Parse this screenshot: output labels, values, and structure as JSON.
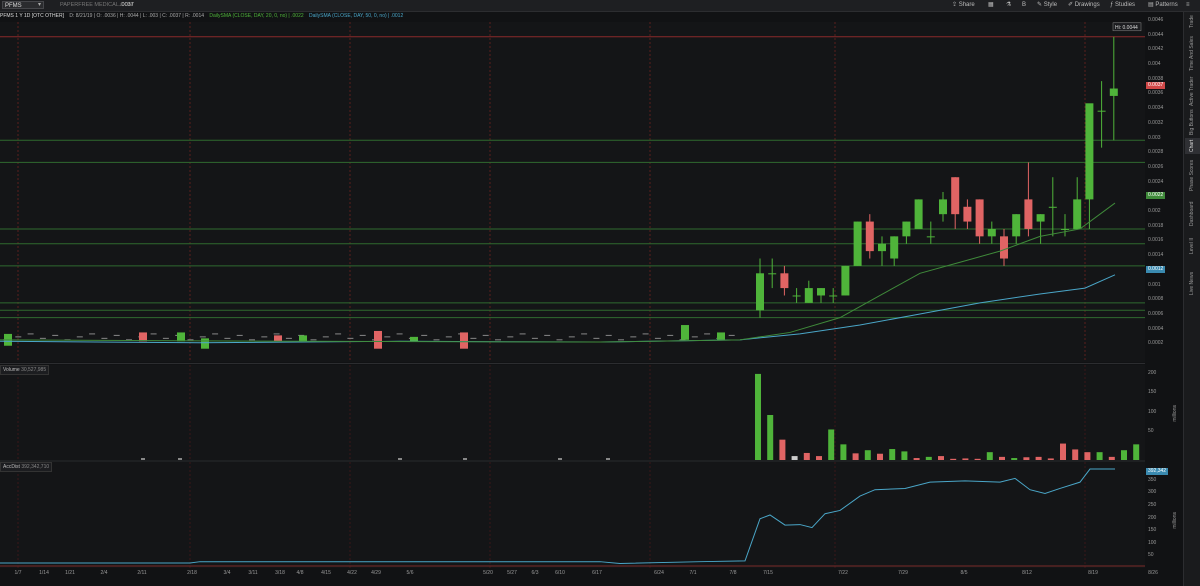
{
  "toolbar": {
    "symbol": "PFMS",
    "symbol_dropdown": "▾",
    "company_name": "PAPERFREE MEDICAL.COM",
    "last_price": ".0037",
    "share_label": "Share",
    "style_label": "Style",
    "drawings_label": "Drawings",
    "studies_label": "Studies",
    "patterns_label": "Patterns"
  },
  "chart_header": {
    "title": "PFMS 1 Y 1D [OTC OTHER]",
    "ohlc": "D: 8/21/19 | O: .0036 | H: .0044 | L: .003 | C: .0037 | R: .0014",
    "sma20": "DailySMA (CLOSE, DAY, 20, 0, no) | .0022",
    "sma50": "DailySMA (CLOSE, DAY, 50, 0, no) | .0012"
  },
  "sidebar_tabs": [
    "Trade",
    "Time And Sales",
    "Active Trader",
    "Big Buttons",
    "Chart",
    "Phase Scores",
    "Dashboard",
    "Level II",
    "Live News"
  ],
  "sidebar_active": "Chart",
  "price_axis": {
    "ticks": [
      "0.0046",
      "0.0044",
      "0.0042",
      "0.004",
      "0.0038",
      "0.0036",
      "0.0034",
      "0.0032",
      "0.003",
      "0.0028",
      "0.0026",
      "0.0024",
      "0.0022",
      "0.002",
      "0.0018",
      "0.0016",
      "0.0014",
      "0.0012",
      "0.001",
      "0.0008",
      "0.0006",
      "0.0004",
      "0.0002"
    ],
    "high_bubble": "Hi: 0.0044",
    "last_tag": "0.0037",
    "sma20_tag": "0.0022",
    "sma50_tag": "0.0012"
  },
  "volume_panel": {
    "label": "Volume",
    "value": "30,527,985",
    "unit": "millions",
    "ticks": [
      "200",
      "150",
      "100",
      "50"
    ]
  },
  "accdist_panel": {
    "label": "AccDist",
    "value": "392,342,710",
    "tag": "392,342",
    "unit": "millions",
    "ticks": [
      "350",
      "300",
      "250",
      "200",
      "150",
      "100",
      "50"
    ]
  },
  "x_axis": [
    "1/7",
    "1/14",
    "1/21",
    "2/4",
    "2/11",
    "2/18",
    "3/4",
    "3/11",
    "3/18",
    "4/8",
    "4/15",
    "4/22",
    "4/29",
    "5/6",
    "5/20",
    "5/27",
    "6/3",
    "6/10",
    "6/17",
    "6/24",
    "7/1",
    "7/8",
    "7/15",
    "7/22",
    "7/29",
    "8/5",
    "8/12",
    "8/19",
    "8/26"
  ],
  "colors": {
    "up": "#4fb43a",
    "down": "#e06464",
    "sma20": "#3f8a3a",
    "sma50": "#4aa6c8",
    "support": "#2f6a2f",
    "resistance": "#8a2a2a"
  },
  "chart_data": {
    "type": "candlestick",
    "ylim": [
      0,
      0.0046
    ],
    "support_levels": [
      0.003,
      0.0027,
      0.0018,
      0.0016,
      0.0013,
      0.0008,
      0.0007,
      0.0006
    ],
    "resistance_level": 0.0044,
    "candles": [
      {
        "x": "7/8",
        "o": 0.0007,
        "h": 0.0014,
        "l": 0.0006,
        "c": 0.0012
      },
      {
        "x": "7/9",
        "o": 0.0012,
        "h": 0.0014,
        "l": 0.001,
        "c": 0.0012
      },
      {
        "x": "7/10",
        "o": 0.0012,
        "h": 0.0013,
        "l": 0.0009,
        "c": 0.001
      },
      {
        "x": "7/11",
        "o": 0.0009,
        "h": 0.001,
        "l": 0.0008,
        "c": 0.0009
      },
      {
        "x": "7/12",
        "o": 0.0008,
        "h": 0.0011,
        "l": 0.0008,
        "c": 0.001
      },
      {
        "x": "7/15",
        "o": 0.0009,
        "h": 0.001,
        "l": 0.0008,
        "c": 0.001
      },
      {
        "x": "7/16",
        "o": 0.0009,
        "h": 0.001,
        "l": 0.0008,
        "c": 0.0009
      },
      {
        "x": "7/17",
        "o": 0.0009,
        "h": 0.0013,
        "l": 0.0009,
        "c": 0.0013
      },
      {
        "x": "7/18",
        "o": 0.0013,
        "h": 0.0019,
        "l": 0.0013,
        "c": 0.0019
      },
      {
        "x": "7/19",
        "o": 0.0019,
        "h": 0.002,
        "l": 0.0014,
        "c": 0.0015
      },
      {
        "x": "7/22",
        "o": 0.0015,
        "h": 0.0017,
        "l": 0.0013,
        "c": 0.0016
      },
      {
        "x": "7/23",
        "o": 0.0014,
        "h": 0.0017,
        "l": 0.0013,
        "c": 0.0017
      },
      {
        "x": "7/24",
        "o": 0.0017,
        "h": 0.0019,
        "l": 0.0016,
        "c": 0.0019
      },
      {
        "x": "7/25",
        "o": 0.0018,
        "h": 0.0022,
        "l": 0.0018,
        "c": 0.0022
      },
      {
        "x": "7/26",
        "o": 0.0017,
        "h": 0.0019,
        "l": 0.0016,
        "c": 0.0017
      },
      {
        "x": "7/29",
        "o": 0.002,
        "h": 0.0023,
        "l": 0.0019,
        "c": 0.0022
      },
      {
        "x": "7/30",
        "o": 0.0025,
        "h": 0.0025,
        "l": 0.0018,
        "c": 0.002
      },
      {
        "x": "7/31",
        "o": 0.0021,
        "h": 0.0022,
        "l": 0.0018,
        "c": 0.0019
      },
      {
        "x": "8/1",
        "o": 0.0022,
        "h": 0.0022,
        "l": 0.0016,
        "c": 0.0017
      },
      {
        "x": "8/2",
        "o": 0.0017,
        "h": 0.0019,
        "l": 0.0016,
        "c": 0.0018
      },
      {
        "x": "8/5",
        "o": 0.0017,
        "h": 0.0018,
        "l": 0.0013,
        "c": 0.0014
      },
      {
        "x": "8/6",
        "o": 0.0017,
        "h": 0.002,
        "l": 0.0016,
        "c": 0.002
      },
      {
        "x": "8/7",
        "o": 0.0022,
        "h": 0.0027,
        "l": 0.0017,
        "c": 0.0018
      },
      {
        "x": "8/8",
        "o": 0.0019,
        "h": 0.002,
        "l": 0.0016,
        "c": 0.002
      },
      {
        "x": "8/9",
        "o": 0.0021,
        "h": 0.0025,
        "l": 0.0017,
        "c": 0.0021
      },
      {
        "x": "8/12",
        "o": 0.0018,
        "h": 0.002,
        "l": 0.0017,
        "c": 0.0018
      },
      {
        "x": "8/13",
        "o": 0.0018,
        "h": 0.0025,
        "l": 0.0018,
        "c": 0.0022
      },
      {
        "x": "8/14",
        "o": 0.0022,
        "h": 0.0026,
        "l": 0.0018,
        "c": 0.0035
      },
      {
        "x": "8/15",
        "o": 0.0034,
        "h": 0.0038,
        "l": 0.0029,
        "c": 0.0034
      },
      {
        "x": "8/16",
        "o": 0.0036,
        "h": 0.0044,
        "l": 0.003,
        "c": 0.0037
      }
    ]
  }
}
